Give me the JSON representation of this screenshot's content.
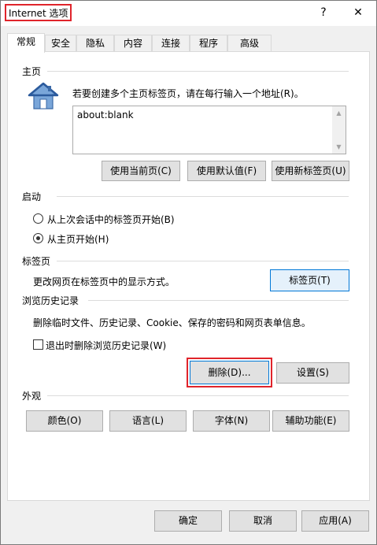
{
  "window": {
    "title": "Internet 选项",
    "help_label": "?",
    "close_label": "✕"
  },
  "tabs": [
    {
      "label": "常规",
      "active": true
    },
    {
      "label": "安全"
    },
    {
      "label": "隐私"
    },
    {
      "label": "内容"
    },
    {
      "label": "连接"
    },
    {
      "label": "程序"
    },
    {
      "label": "高级"
    }
  ],
  "homepage": {
    "group_label": "主页",
    "instruction": "若要创建多个主页标签页，请在每行输入一个地址(R)。",
    "value": "about:blank",
    "btn_current": "使用当前页(C)",
    "btn_default": "使用默认值(F)",
    "btn_newtab": "使用新标签页(U)"
  },
  "startup": {
    "group_label": "启动",
    "option1": "从上次会话中的标签页开始(B)",
    "option2": "从主页开始(H)",
    "selected": 2
  },
  "tabs_section": {
    "group_label": "标签页",
    "description": "更改网页在标签页中的显示方式。",
    "button": "标签页(T)"
  },
  "history": {
    "group_label": "浏览历史记录",
    "description": "删除临时文件、历史记录、Cookie、保存的密码和网页表单信息。",
    "checkbox_label": "退出时删除浏览历史记录(W)",
    "checked": false,
    "delete_button": "删除(D)...",
    "settings_button": "设置(S)"
  },
  "appearance": {
    "group_label": "外观",
    "colors": "颜色(O)",
    "languages": "语言(L)",
    "fonts": "字体(N)",
    "accessibility": "辅助功能(E)"
  },
  "footer": {
    "ok": "确定",
    "cancel": "取消",
    "apply": "应用(A)"
  },
  "colors": {
    "highlight": "#e0242b",
    "focus": "#0078d7"
  }
}
